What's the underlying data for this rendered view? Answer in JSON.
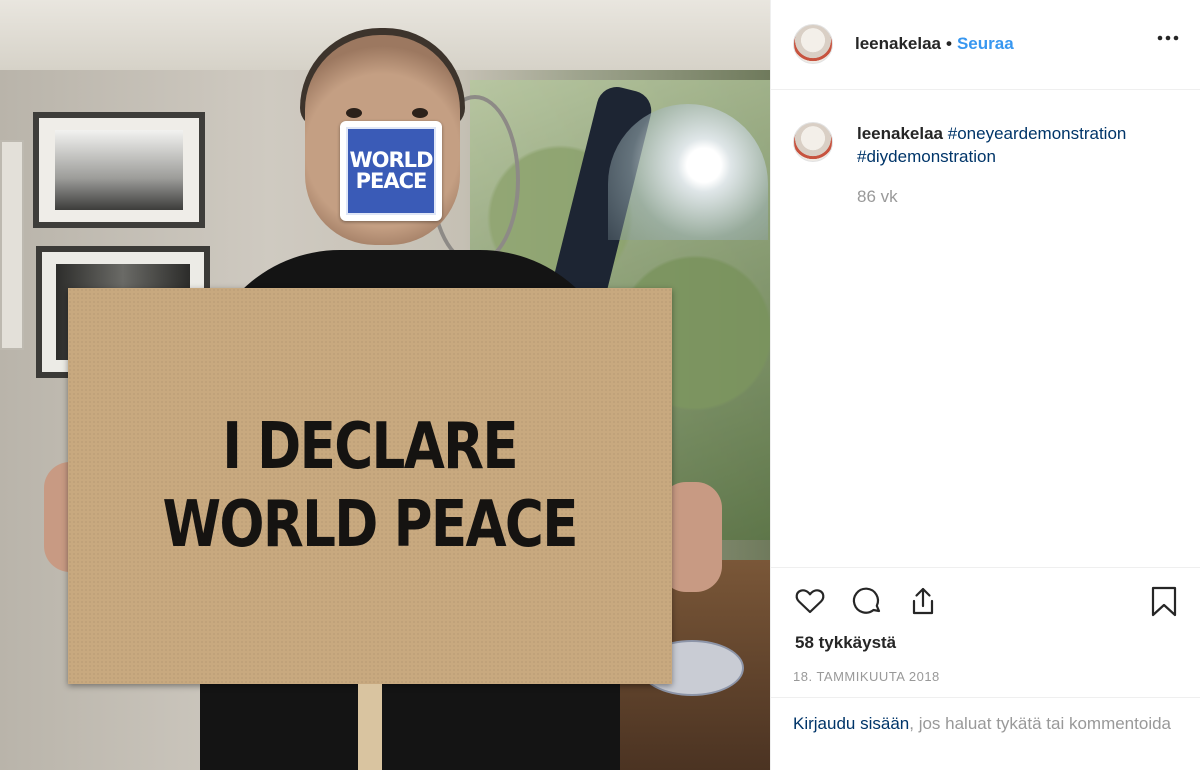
{
  "header": {
    "username": "leenakelaa",
    "separator": "•",
    "follow_label": "Seuraa",
    "more_icon": "more-options-icon"
  },
  "photo": {
    "sign_line_1": "I DECLARE",
    "sign_line_2": "WORLD PEACE",
    "sticker_line_1": "WORLD",
    "sticker_line_2": "PEACE"
  },
  "caption": {
    "username": "leenakelaa",
    "hashtag_1": "#oneyeardemonstration",
    "hashtag_2": "#diydemonstration",
    "time_ago": "86 vk"
  },
  "actions": {
    "like_icon": "heart-icon",
    "comment_icon": "comment-icon",
    "share_icon": "share-icon",
    "save_icon": "bookmark-icon"
  },
  "likes_text": "58 tykkäystä",
  "date_text": "18. TAMMIKUUTA 2018",
  "login": {
    "link_text": "Kirjaudu sisään",
    "rest_text": ", jos haluat tykätä tai kommentoida"
  },
  "colors": {
    "follow_blue": "#3897f0",
    "tag_blue": "#003569",
    "muted_gray": "#999999"
  }
}
